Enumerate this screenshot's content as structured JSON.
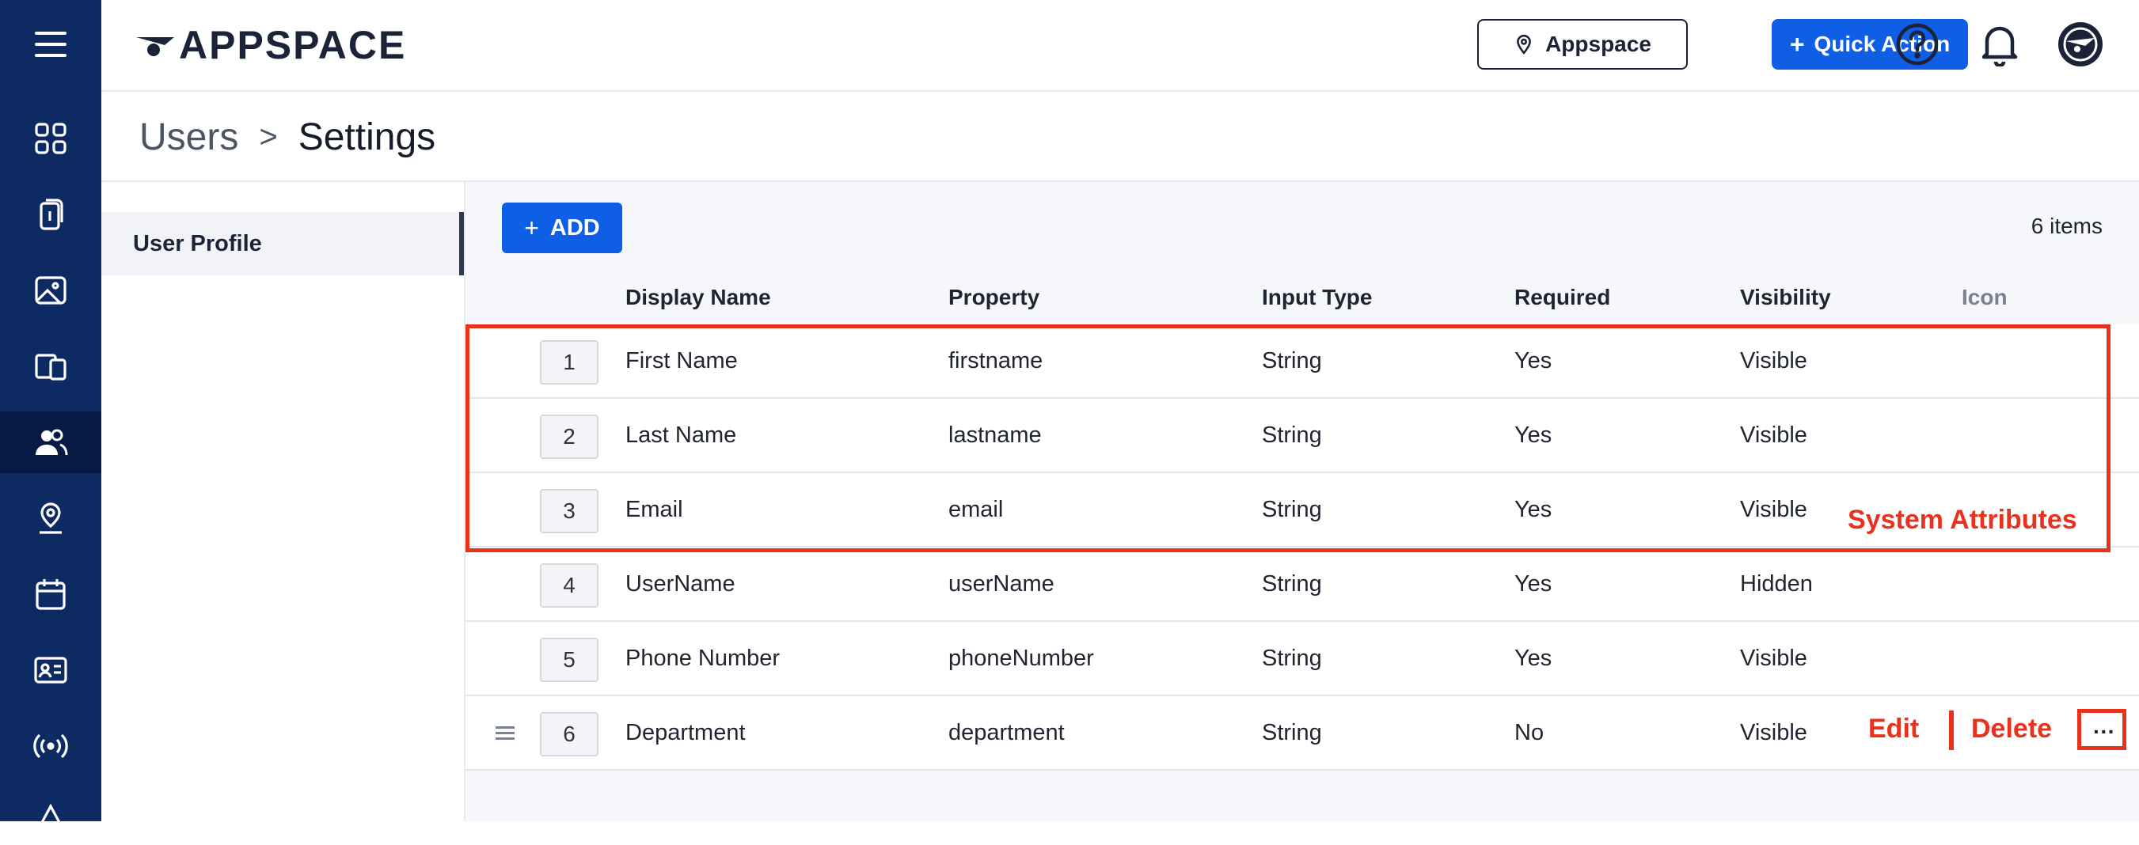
{
  "brand": {
    "name": "APPSPACE",
    "accent": "#0e5ee6",
    "nav_bg": "#0d2a63",
    "annotation_color": "#e8321e"
  },
  "topbar": {
    "location_button": "Appspace",
    "quick_action_button": "Quick Action",
    "icons": [
      "help-icon",
      "bell-icon",
      "account-icon"
    ]
  },
  "nav": {
    "items": [
      "menu-icon",
      "dashboard-icon",
      "channels-icon",
      "library-icon",
      "devices-icon",
      "users-icon",
      "places-icon",
      "calendar-icon",
      "id-card-icon",
      "broadcast-icon",
      "alert-icon"
    ],
    "active": "users-icon"
  },
  "breadcrumb": {
    "parent": "Users",
    "separator": ">",
    "current": "Settings"
  },
  "subnav": {
    "items": [
      {
        "label": "User Profile",
        "active": true
      }
    ]
  },
  "toolbar": {
    "add_label": "ADD",
    "add_icon": "+",
    "count_label": "6 items"
  },
  "table": {
    "columns": [
      "Display Name",
      "Property",
      "Input Type",
      "Required",
      "Visibility",
      "Icon"
    ],
    "rows": [
      {
        "index": "1",
        "display_name": "First Name",
        "property": "firstname",
        "input_type": "String",
        "required": "Yes",
        "visibility": "Visible"
      },
      {
        "index": "2",
        "display_name": "Last Name",
        "property": "lastname",
        "input_type": "String",
        "required": "Yes",
        "visibility": "Visible"
      },
      {
        "index": "3",
        "display_name": "Email",
        "property": "email",
        "input_type": "String",
        "required": "Yes",
        "visibility": "Visible"
      },
      {
        "index": "4",
        "display_name": "UserName",
        "property": "userName",
        "input_type": "String",
        "required": "Yes",
        "visibility": "Hidden"
      },
      {
        "index": "5",
        "display_name": "Phone Number",
        "property": "phoneNumber",
        "input_type": "String",
        "required": "Yes",
        "visibility": "Visible"
      },
      {
        "index": "6",
        "display_name": "Department",
        "property": "department",
        "input_type": "String",
        "required": "No",
        "visibility": "Visible"
      }
    ],
    "row_actions": {
      "more_label": "···"
    }
  },
  "annotations": {
    "system_attributes": "System Attributes",
    "edit": "Edit",
    "delete": "Delete"
  }
}
